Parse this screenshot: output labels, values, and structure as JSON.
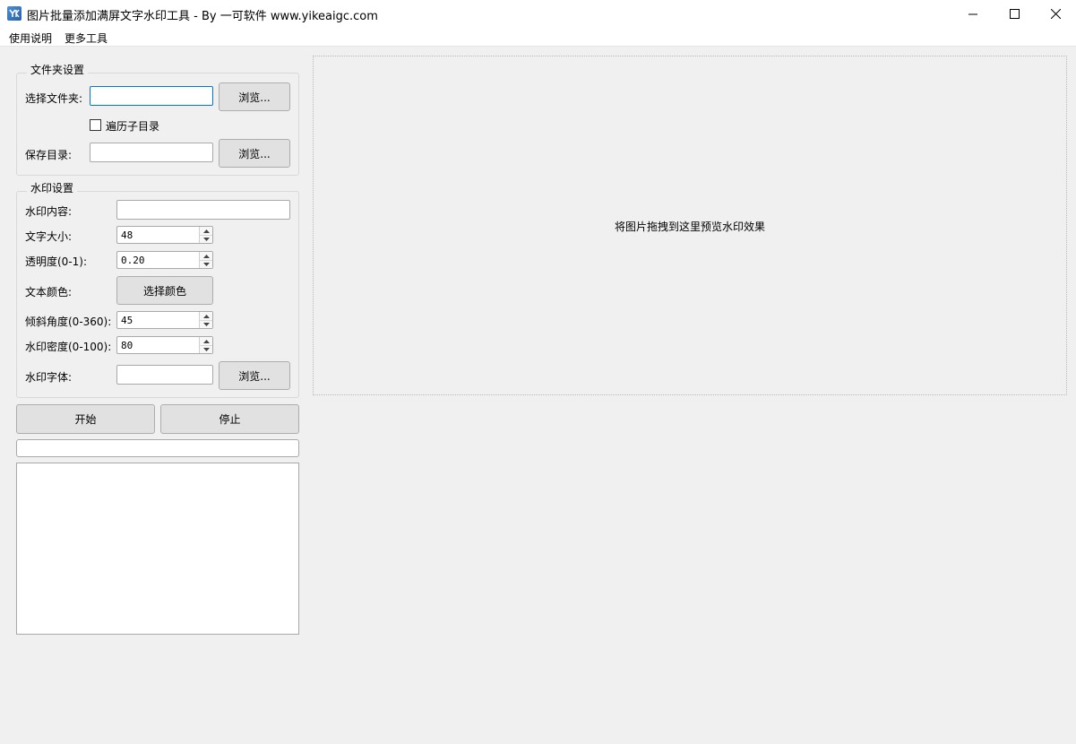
{
  "window": {
    "title": "图片批量添加满屏文字水印工具 - By 一可软件 www.yikeaigc.com",
    "app_icon": "app-logo-icon",
    "controls": [
      "minimize-icon",
      "maximize-icon",
      "close-icon"
    ]
  },
  "menu": {
    "items": [
      {
        "label": "使用说明"
      },
      {
        "label": "更多工具"
      }
    ]
  },
  "folder_settings": {
    "title": "文件夹设置",
    "select_folder_label": "选择文件夹:",
    "select_folder_value": "",
    "browse_label": "浏览...",
    "traverse_subdirs_label": "遍历子目录",
    "traverse_subdirs_checked": false,
    "save_dir_label": "保存目录:",
    "save_dir_value": "",
    "browse2_label": "浏览..."
  },
  "watermark_settings": {
    "title": "水印设置",
    "content_label": "水印内容:",
    "content_value": "",
    "font_size_label": "文字大小:",
    "font_size_value": "48",
    "opacity_label": "透明度(0-1):",
    "opacity_value": "0.20",
    "color_label": "文本颜色:",
    "color_button_label": "选择颜色",
    "angle_label": "倾斜角度(0-360):",
    "angle_value": "45",
    "density_label": "水印密度(0-100):",
    "density_value": "80",
    "font_label": "水印字体:",
    "font_value": "",
    "font_browse_label": "浏览..."
  },
  "actions": {
    "start_label": "开始",
    "stop_label": "停止"
  },
  "progress": {
    "value": 0
  },
  "log": {
    "text": ""
  },
  "preview": {
    "hint": "将图片拖拽到这里预览水印效果"
  },
  "colors": {
    "accent": "#0078d7",
    "window_bg": "#f0f0f0"
  }
}
